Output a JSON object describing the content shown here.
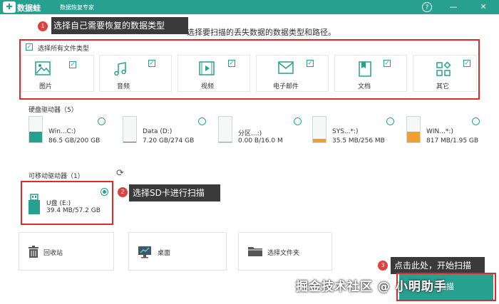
{
  "app": {
    "logo": "✚",
    "name": "数据蛙",
    "subtitle": "数据恢复专家"
  },
  "window_controls": {
    "help": "?",
    "minimize": "—",
    "close": "✕"
  },
  "annotations": {
    "step1": {
      "badge": "1",
      "text": "选择自己需要恢复的数据类型"
    },
    "step2": {
      "badge": "2",
      "text": "选择SD卡进行扫描"
    },
    "step3": {
      "badge": "3",
      "text": "点击此处，开始扫描"
    },
    "color": "#e02a2a"
  },
  "instruction_fragment": "选择要扫描的丢失数据的数据类型和路径。",
  "file_types": {
    "select_all_label": "选择所有文件类型",
    "items": [
      {
        "label": "图片",
        "icon": "image-icon"
      },
      {
        "label": "音频",
        "icon": "music-icon"
      },
      {
        "label": "视频",
        "icon": "video-icon"
      },
      {
        "label": "电子邮件",
        "icon": "email-icon"
      },
      {
        "label": "文档",
        "icon": "document-icon"
      },
      {
        "label": "其它",
        "icon": "other-icon"
      }
    ]
  },
  "hard_drives": {
    "title": "硬盘驱动器（5）",
    "items": [
      {
        "name": "Win...C:)",
        "size": "86.5 GB/200 GB",
        "used_fraction": 0.43,
        "fill_color": "#27a08f"
      },
      {
        "name": "Data (D:)",
        "size": "7.20 GB/274 GB",
        "used_fraction": 0.03,
        "fill_color": "#27a08f"
      },
      {
        "name": "分区...:)",
        "size": "0.00  B/16.0 M",
        "used_fraction": 0.0,
        "fill_color": "#f0a030"
      },
      {
        "name": "SYS...*:)",
        "size": "35.5 MB/256 MB",
        "used_fraction": 0.14,
        "fill_color": "#f0a030"
      },
      {
        "name": "WIN...*:)",
        "size": "817 MB/1.95 GB",
        "used_fraction": 0.42,
        "fill_color": "#f0a030"
      }
    ]
  },
  "removable_drives": {
    "title": "可移动驱动器（1）",
    "items": [
      {
        "name": "U盘 (E:)",
        "size": "39.4 MB/57.2 GB"
      }
    ]
  },
  "locations": [
    {
      "label": "回收站",
      "icon": "trash-icon"
    },
    {
      "label": "桌面",
      "icon": "desktop-icon"
    },
    {
      "label": "选择文件夹",
      "icon": "folder-icon"
    }
  ],
  "scan_button": "扫描",
  "watermark": "掘金技术社区 @ 小明助手",
  "colors": {
    "accent": "#27a08f",
    "titlebar": "#27a08f",
    "orange": "#f0a030"
  }
}
